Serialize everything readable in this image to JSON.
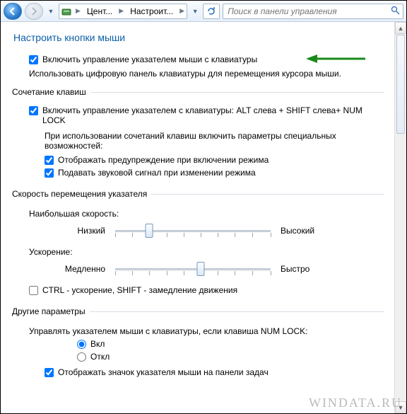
{
  "addrbar": {
    "breadcrumb": {
      "seg1": "Цент...",
      "seg2": "Настроит..."
    },
    "search_placeholder": "Поиск в панели управления"
  },
  "page": {
    "title": "Настроить кнопки мыши"
  },
  "main": {
    "enable_mousekeys_label": "Включить управление указателем мыши с клавиатуры",
    "enable_mousekeys_desc": "Использовать цифровую панель клавиатуры для перемещения курсора мыши."
  },
  "shortcut": {
    "legend": "Сочетание клавиш",
    "enable_combo_label": "Включить управление указателем с клавиатуры: ALT слева + SHIFT слева+ NUM LOCK",
    "on_use_sub": "При использовании сочетаний клавиш включить параметры специальных возможностей:",
    "warn_label": "Отображать предупреждение при включении режима",
    "sound_label": "Подавать звуковой сигнал при изменении режима"
  },
  "speed": {
    "legend": "Скорость перемещения указателя",
    "max_speed_label": "Наибольшая скорость:",
    "low": "Низкий",
    "high": "Высокий",
    "accel_label": "Ускорение:",
    "slow": "Медленно",
    "fast": "Быстро",
    "ctrl_shift_label": "CTRL - ускорение, SHIFT - замедление движения"
  },
  "other": {
    "legend": "Другие параметры",
    "numlock_q": "Управлять указателем мыши с клавиатуры, если клавиша NUM LOCK:",
    "opt_on": "Вкл",
    "opt_off": "Откл",
    "show_icon_label": "Отображать значок указателя мыши на панели задач"
  },
  "watermark": "WINDATA.RU"
}
